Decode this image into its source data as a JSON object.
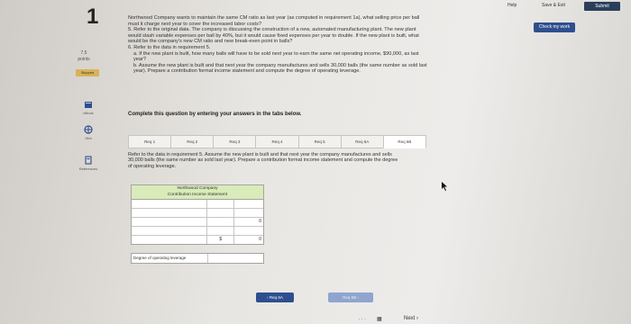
{
  "topbar": {
    "help": "Help",
    "save_exit": "Save & Exit",
    "submit": "Submit"
  },
  "check_work": "Check my work",
  "question": {
    "number": "1",
    "points_value": "7.5",
    "points_label": "points",
    "status": "Skipped"
  },
  "sidebar": [
    {
      "label": "eBook",
      "icon": "book-icon"
    },
    {
      "label": "Hint",
      "icon": "hint-icon"
    },
    {
      "label": "References",
      "icon": "references-icon"
    }
  ],
  "prompt_lines": [
    "Northwood Company wants to maintain the same CM ratio as last year (as computed in requirement 1a), what selling price per ball",
    "must it charge next year to cover the increased labor costs?",
    "5. Refer to the original data. The company is discussing the construction of a new, automated manufacturing plant. The new plant",
    "would slash variable expenses per ball by 40%, but it would cause fixed expenses per year to double. If the new plant is built, what",
    "would be the company's new CM ratio and new break-even point in balls?",
    "6. Refer to the data in requirement 5.",
    "a. If the new plant is built, how many balls will have to be sold next year to earn the same net operating income, $90,000, as last",
    "year?",
    "b. Assume the new plant is built and that next year the company manufactures and sells 30,000 balls (the same number as sold last",
    "year). Prepare a contribution format income statement and compute the degree of operating leverage."
  ],
  "instruction": "Complete this question by entering your answers in the tabs below.",
  "tabs": [
    "Req 1",
    "Req 2",
    "Req 3",
    "Req 4",
    "Req 5",
    "Req 6A",
    "Req 6B"
  ],
  "refer_text": "Refer to the data in requirement 5. Assume the new plant is built and that next year the company manufactures and sells 30,000 balls (the same number as sold last year). Prepare a contribution format income statement and compute the degree of operating leverage.",
  "statement": {
    "company": "Northwood Company",
    "title": "Contribution Income Statement",
    "rows": [
      {
        "label": "",
        "col2": "",
        "col3": ""
      },
      {
        "label": "",
        "col2": "",
        "col3": ""
      },
      {
        "label": "",
        "col2": "",
        "col3": "0"
      },
      {
        "label": "",
        "col2": "",
        "col3": ""
      },
      {
        "label": "",
        "col2": "$",
        "col3": "0"
      }
    ],
    "dol_label": "Degree of operating leverage"
  },
  "nav": {
    "prev": "Req 6A",
    "next": "Req 6B"
  },
  "footer": {
    "next": "Next"
  }
}
